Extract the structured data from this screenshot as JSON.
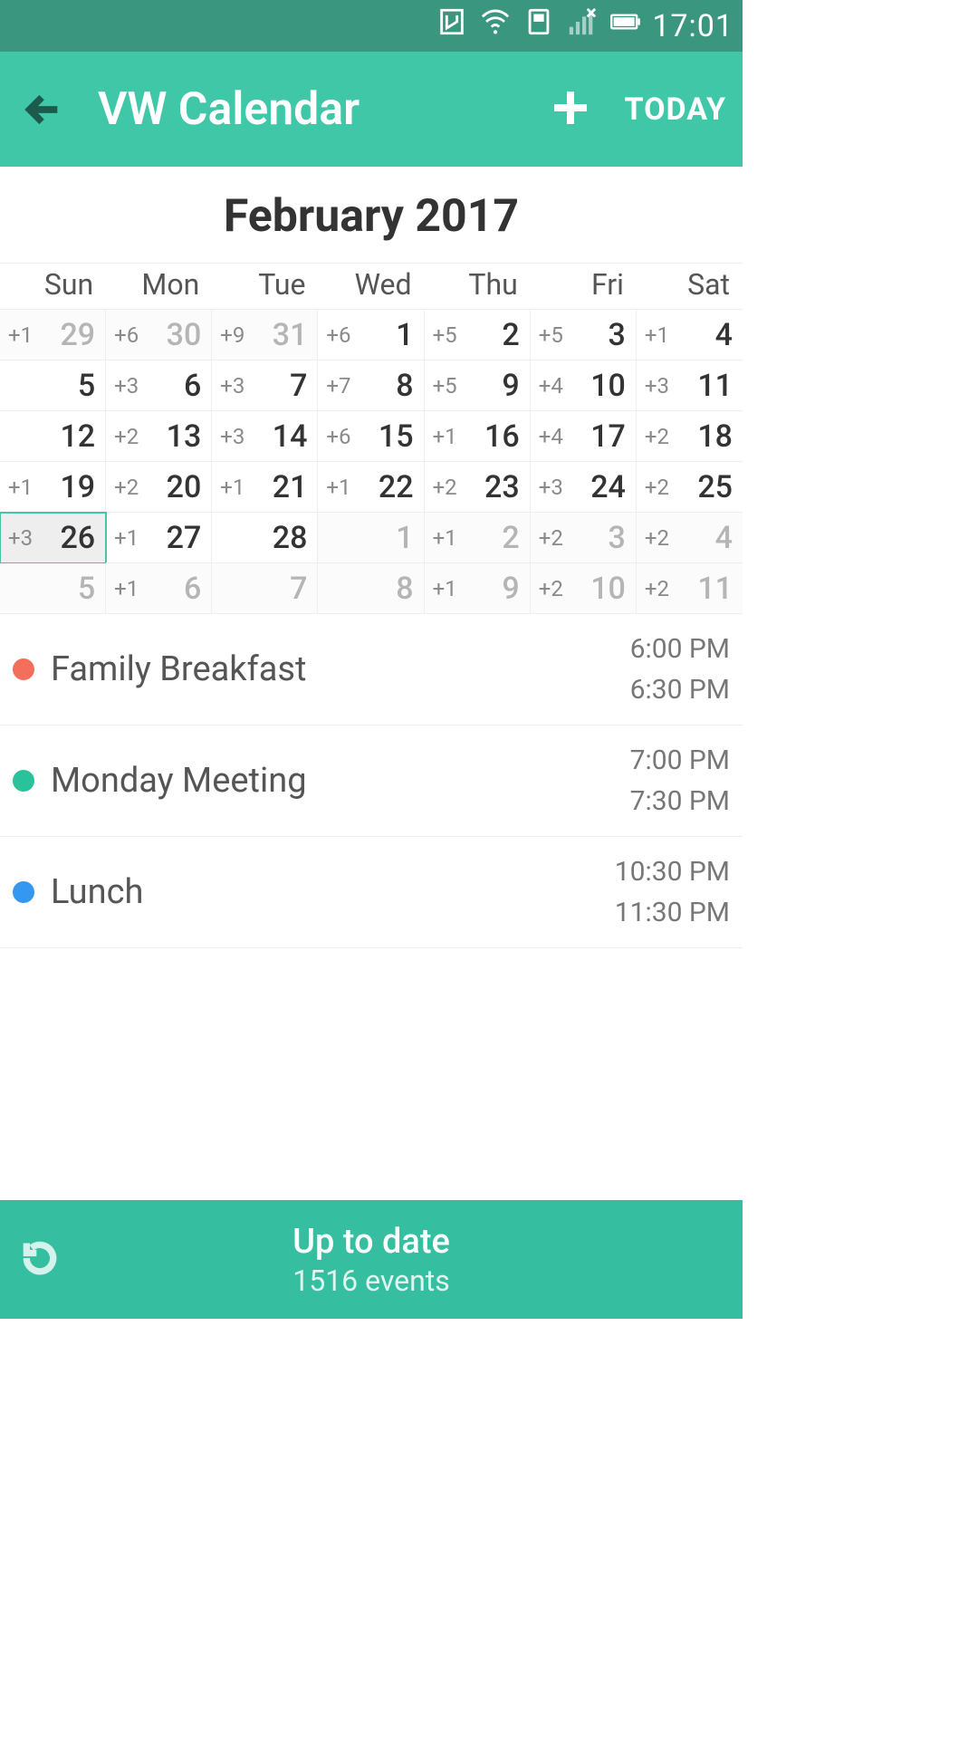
{
  "status": {
    "time": "17:01"
  },
  "header": {
    "title": "VW Calendar",
    "today": "TODAY"
  },
  "month": "February 2017",
  "weekdays": [
    "Sun",
    "Mon",
    "Tue",
    "Wed",
    "Thu",
    "Fri",
    "Sat"
  ],
  "grid": [
    [
      {
        "cnt": "+1",
        "day": "29",
        "out": true
      },
      {
        "cnt": "+6",
        "day": "30",
        "out": true
      },
      {
        "cnt": "+9",
        "day": "31",
        "out": true
      },
      {
        "cnt": "+6",
        "day": "1"
      },
      {
        "cnt": "+5",
        "day": "2"
      },
      {
        "cnt": "+5",
        "day": "3"
      },
      {
        "cnt": "+1",
        "day": "4"
      }
    ],
    [
      {
        "cnt": "",
        "day": "5"
      },
      {
        "cnt": "+3",
        "day": "6"
      },
      {
        "cnt": "+3",
        "day": "7"
      },
      {
        "cnt": "+7",
        "day": "8"
      },
      {
        "cnt": "+5",
        "day": "9"
      },
      {
        "cnt": "+4",
        "day": "10"
      },
      {
        "cnt": "+3",
        "day": "11"
      }
    ],
    [
      {
        "cnt": "",
        "day": "12"
      },
      {
        "cnt": "+2",
        "day": "13"
      },
      {
        "cnt": "+3",
        "day": "14"
      },
      {
        "cnt": "+6",
        "day": "15"
      },
      {
        "cnt": "+1",
        "day": "16"
      },
      {
        "cnt": "+4",
        "day": "17"
      },
      {
        "cnt": "+2",
        "day": "18"
      }
    ],
    [
      {
        "cnt": "+1",
        "day": "19"
      },
      {
        "cnt": "+2",
        "day": "20"
      },
      {
        "cnt": "+1",
        "day": "21"
      },
      {
        "cnt": "+1",
        "day": "22"
      },
      {
        "cnt": "+2",
        "day": "23"
      },
      {
        "cnt": "+3",
        "day": "24"
      },
      {
        "cnt": "+2",
        "day": "25"
      }
    ],
    [
      {
        "cnt": "+3",
        "day": "26",
        "sel": true
      },
      {
        "cnt": "+1",
        "day": "27"
      },
      {
        "cnt": "",
        "day": "28"
      },
      {
        "cnt": "",
        "day": "1",
        "out": true
      },
      {
        "cnt": "+1",
        "day": "2",
        "out": true
      },
      {
        "cnt": "+2",
        "day": "3",
        "out": true
      },
      {
        "cnt": "+2",
        "day": "4",
        "out": true
      }
    ],
    [
      {
        "cnt": "",
        "day": "5",
        "out": true
      },
      {
        "cnt": "+1",
        "day": "6",
        "out": true
      },
      {
        "cnt": "",
        "day": "7",
        "out": true
      },
      {
        "cnt": "",
        "day": "8",
        "out": true
      },
      {
        "cnt": "+1",
        "day": "9",
        "out": true
      },
      {
        "cnt": "+2",
        "day": "10",
        "out": true
      },
      {
        "cnt": "+2",
        "day": "11",
        "out": true
      }
    ]
  ],
  "events": [
    {
      "color": "#f36f5c",
      "title": "Family Breakfast",
      "start": "6:00 PM",
      "end": "6:30 PM"
    },
    {
      "color": "#2ac29a",
      "title": "Monday Meeting",
      "start": "7:00 PM",
      "end": "7:30 PM"
    },
    {
      "color": "#3498f0",
      "title": "Lunch",
      "start": "10:30 PM",
      "end": "11:30 PM"
    }
  ],
  "footer": {
    "line1": "Up to date",
    "line2": "1516 events"
  }
}
